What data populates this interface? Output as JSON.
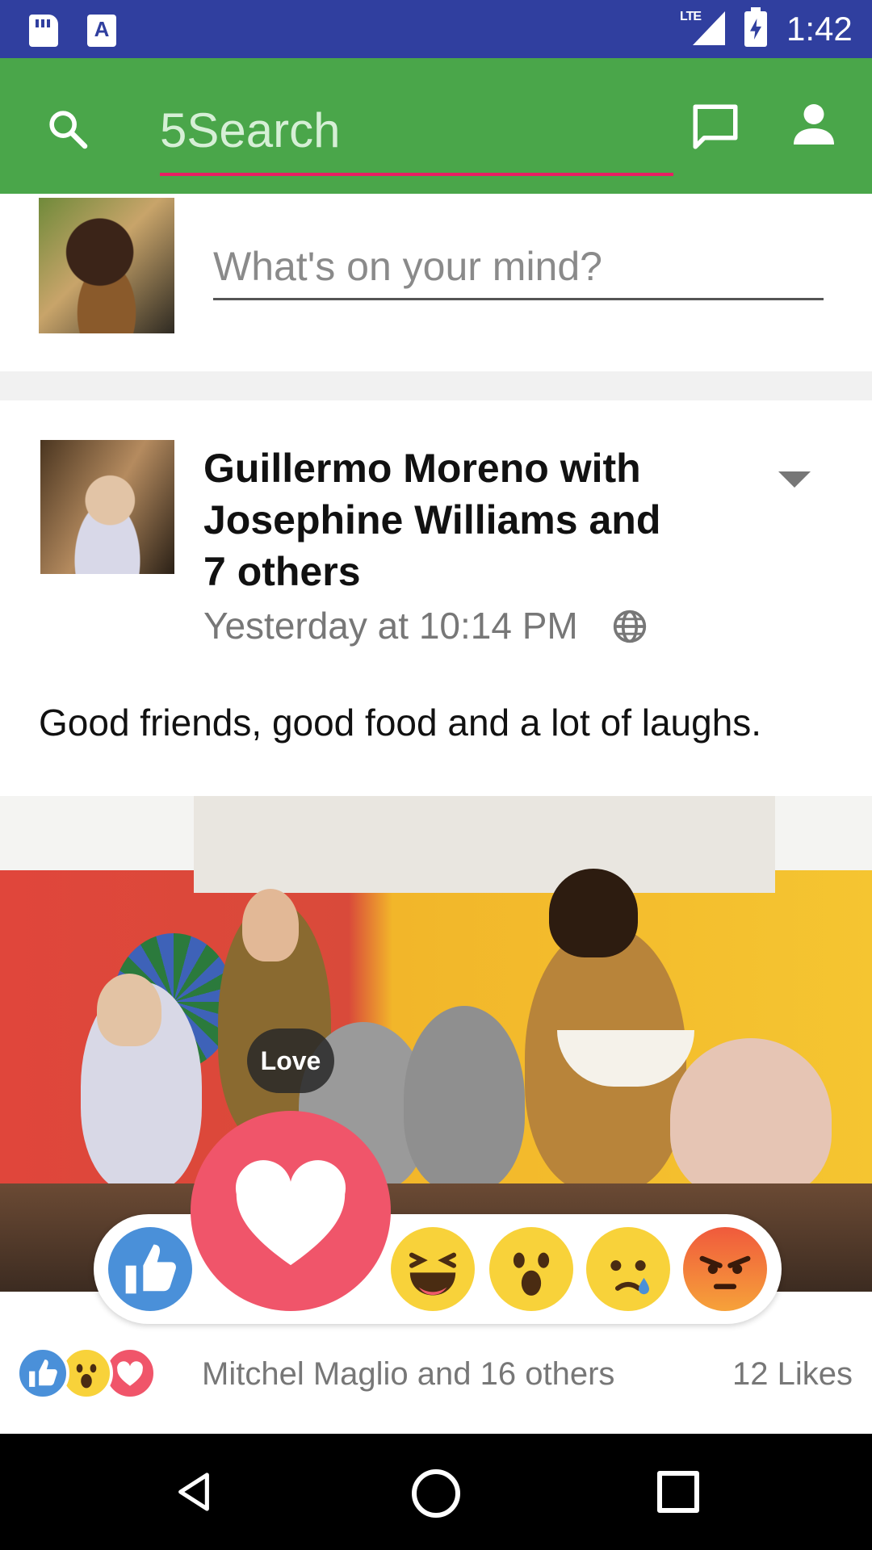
{
  "status_bar": {
    "network": "LTE",
    "time": "1:42",
    "notification_a": "A"
  },
  "app_bar": {
    "search_value": "5Search"
  },
  "composer": {
    "placeholder": "What's on your mind?"
  },
  "post": {
    "title": "Guillermo Moreno with Josephine Williams and 7 others",
    "timestamp": "Yesterday at 10:14 PM",
    "text": "Good friends, good food and a lot of laughs.",
    "hovered_reaction_label": "Love",
    "reactions": [
      "like",
      "love",
      "haha",
      "wow",
      "sad",
      "angry"
    ],
    "reactors_summary": "Mitchel Maglio and 16 others",
    "likes": "12 Likes"
  },
  "colors": {
    "status_bar": "#303f9f",
    "app_bar": "#4aa64a",
    "accent_underline": "#e91e63",
    "love": "#f0556a",
    "like": "#4a90d9"
  }
}
